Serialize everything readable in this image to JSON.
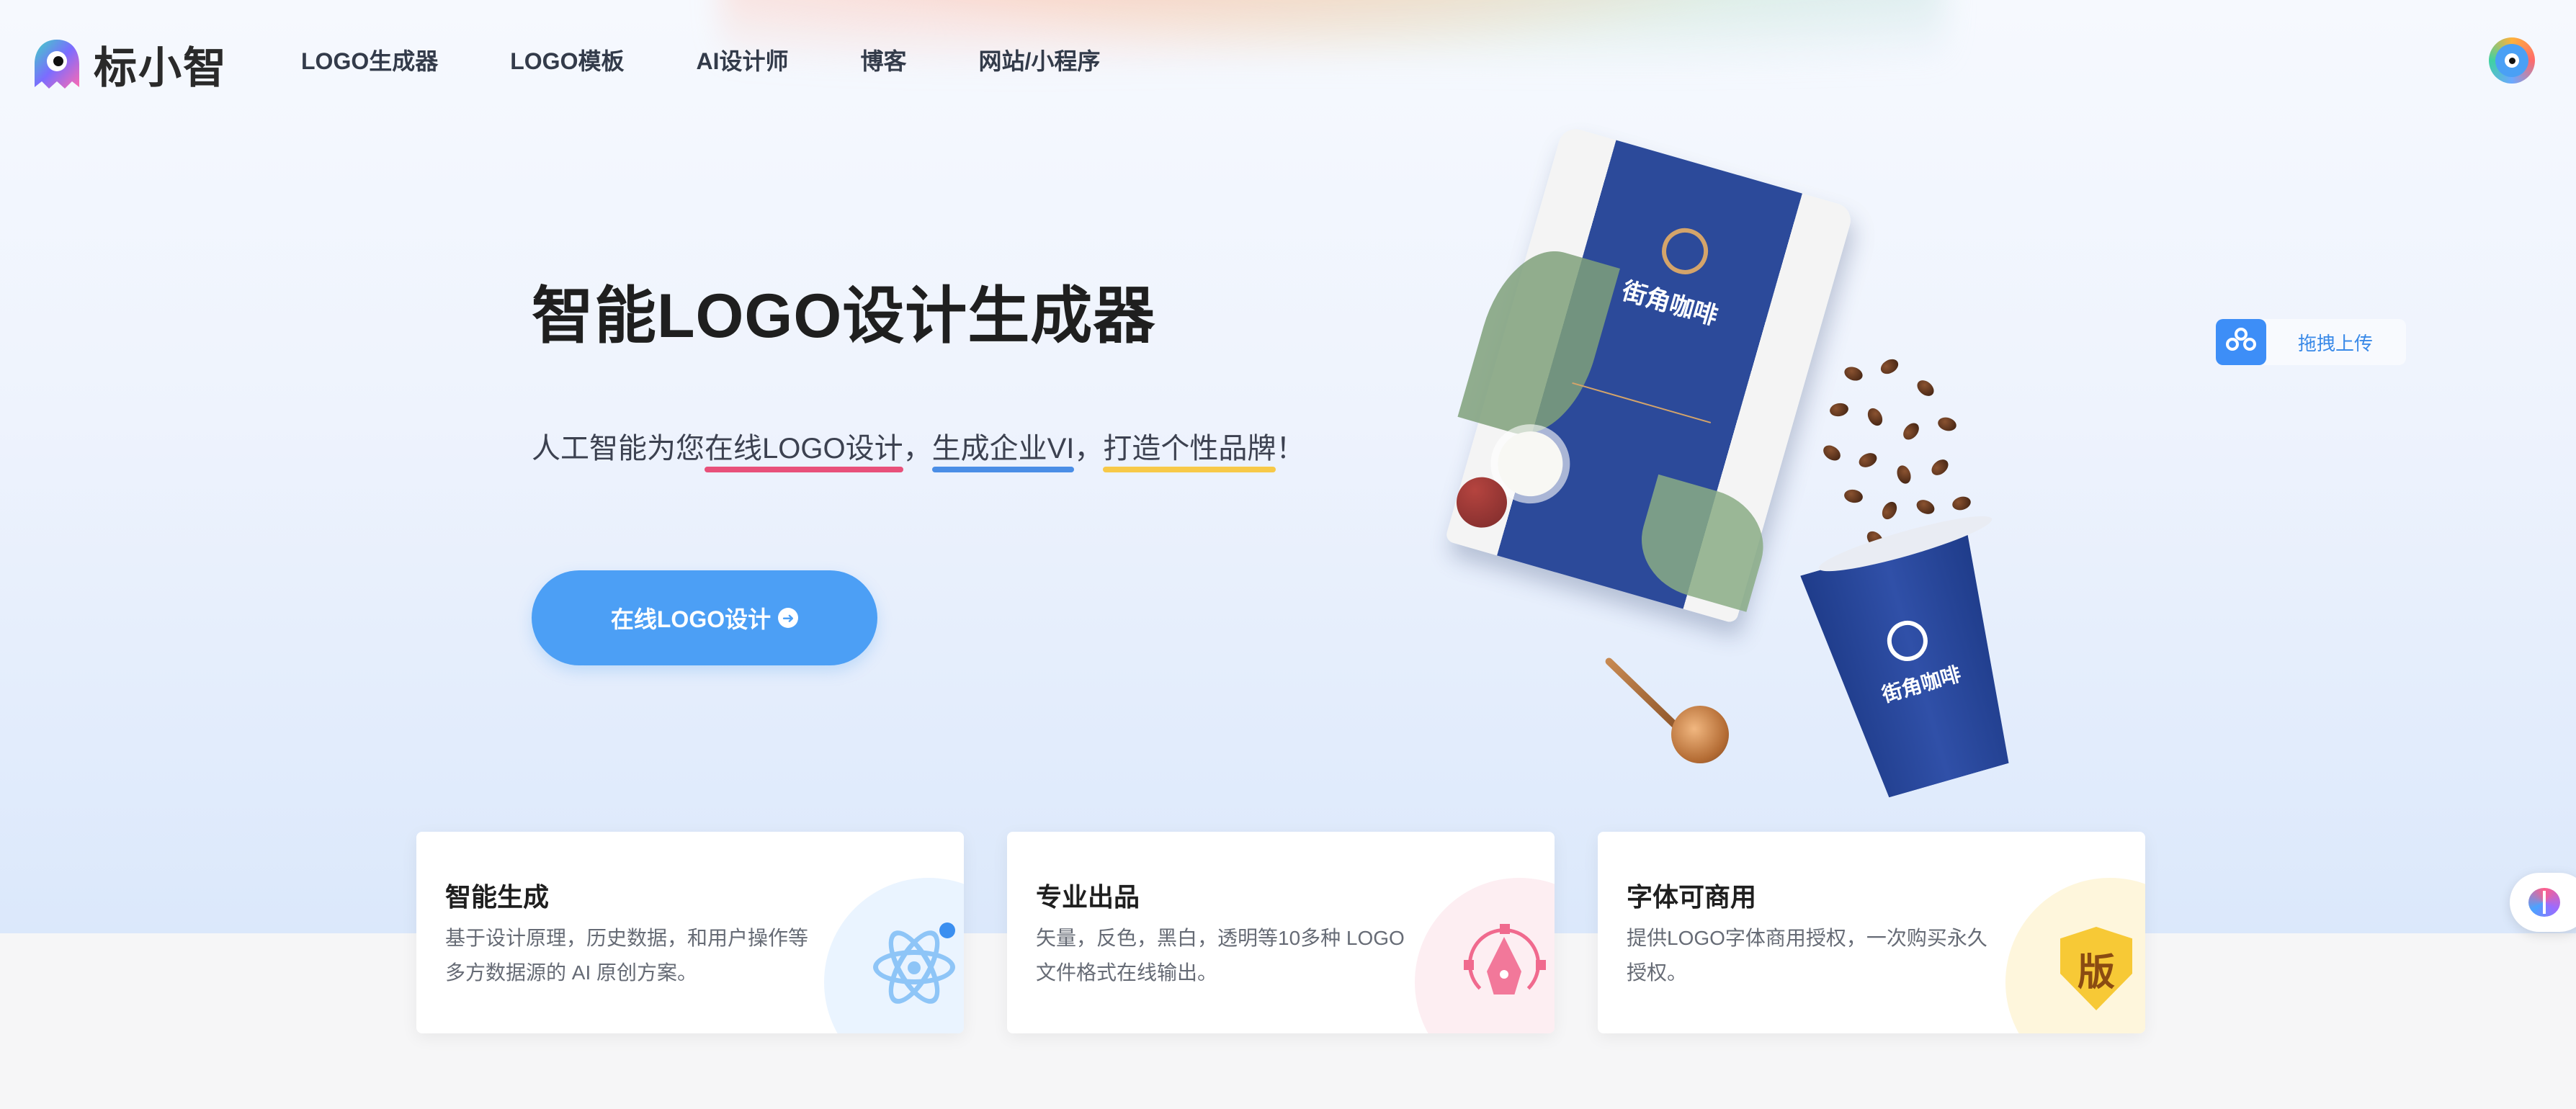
{
  "brand": {
    "name": "标小智"
  },
  "nav": {
    "items": [
      {
        "label": "LOGO生成器"
      },
      {
        "label": "LOGO模板"
      },
      {
        "label": "AI设计师"
      },
      {
        "label": "博客"
      },
      {
        "label": "网站/小程序"
      }
    ]
  },
  "hero": {
    "title": "智能LOGO设计生成器",
    "subtitle_prefix": "人工智能为您",
    "highlight_1": "在线LOGO设计",
    "sep_1": "，",
    "highlight_2": "生成企业VI",
    "sep_2": "，",
    "highlight_3": "打造个性品牌",
    "subtitle_suffix": "！",
    "cta_label": "在线LOGO设计",
    "accent_color": "#4c9ff5"
  },
  "product": {
    "bag_label": "街角咖啡",
    "cup_label": "街角咖啡"
  },
  "upload": {
    "label": "拖拽上传"
  },
  "features": [
    {
      "title": "智能生成",
      "desc": "基于设计原理，历史数据，和用户操作等多方数据源的 AI 原创方案。",
      "icon": "atom-icon",
      "circle_color": "#eaf4ff"
    },
    {
      "title": "专业出品",
      "desc": "矢量，反色，黑白，透明等10多种 LOGO 文件格式在线输出。",
      "icon": "pen-tool-icon",
      "circle_color": "#fdeef2"
    },
    {
      "title": "字体可商用",
      "desc": "提供LOGO字体商用授权，一次购买永久授权。",
      "icon": "shield-icon",
      "icon_text": "版",
      "circle_color": "#fef6dc"
    }
  ]
}
